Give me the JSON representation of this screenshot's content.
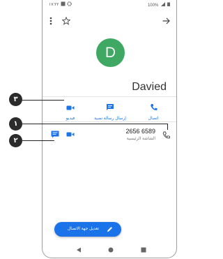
{
  "status_bar": {
    "time": "١٧:٢٢",
    "battery": "100%"
  },
  "contact": {
    "initial": "D",
    "name": "Davied"
  },
  "actions": [
    {
      "label": "فيديو"
    },
    {
      "label": "إرسال رسالة نصية"
    },
    {
      "label": "اتصال"
    }
  ],
  "number_row": {
    "number": "2656 6589",
    "type": "الشاشة الرئيسية"
  },
  "fab": {
    "label": "تعديل جهة الاتصال"
  },
  "callouts": {
    "one": "١",
    "two": "٢",
    "three": "٣"
  },
  "colors": {
    "accent": "#1a73e8",
    "avatar": "#3fa862"
  }
}
